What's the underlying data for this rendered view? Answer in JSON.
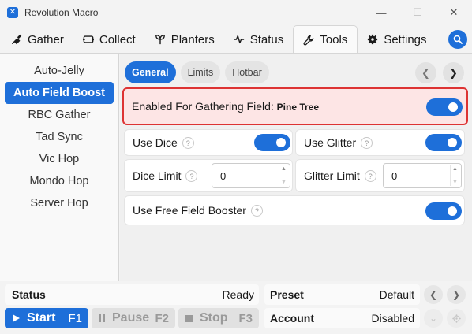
{
  "window": {
    "title": "Revolution Macro",
    "minimize": "—",
    "maximize": "☐",
    "close": "✕"
  },
  "tabs": [
    {
      "label": "Gather",
      "icon": "shovel-icon"
    },
    {
      "label": "Collect",
      "icon": "ticket-icon"
    },
    {
      "label": "Planters",
      "icon": "sprout-icon"
    },
    {
      "label": "Status",
      "icon": "pulse-icon"
    },
    {
      "label": "Tools",
      "icon": "wrench-icon"
    },
    {
      "label": "Settings",
      "icon": "gear-icon"
    }
  ],
  "active_tab": "Tools",
  "sidebar": {
    "items": [
      "Auto-Jelly",
      "Auto Field Boost",
      "RBC Gather",
      "Tad Sync",
      "Vic Hop",
      "Mondo Hop",
      "Server Hop"
    ],
    "active": "Auto Field Boost"
  },
  "subtabs": {
    "items": [
      "General",
      "Limits",
      "Hotbar"
    ],
    "active": "General"
  },
  "main": {
    "enabled_label": "Enabled For Gathering Field:",
    "enabled_field": "Pine Tree",
    "use_dice": "Use Dice",
    "use_glitter": "Use Glitter",
    "dice_limit": "Dice Limit",
    "dice_limit_value": "0",
    "glitter_limit": "Glitter Limit",
    "glitter_limit_value": "0",
    "use_free_field_booster": "Use Free Field Booster",
    "help": "?"
  },
  "bottom": {
    "status_label": "Status",
    "status_value": "Ready",
    "start_label": "Start",
    "start_key": "F1",
    "pause_label": "Pause",
    "pause_key": "F2",
    "stop_label": "Stop",
    "stop_key": "F3",
    "preset_label": "Preset",
    "preset_value": "Default",
    "account_label": "Account",
    "account_value": "Disabled"
  },
  "colors": {
    "accent": "#1e6fd9",
    "warning_border": "#dd3333",
    "warning_bg": "#fde5e5"
  }
}
